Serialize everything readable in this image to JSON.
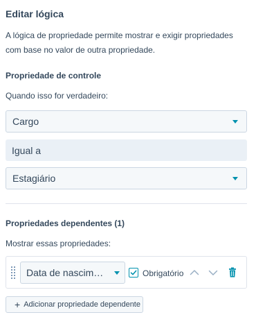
{
  "panel": {
    "title": "Editar lógica",
    "description": "A lógica de propriedade permite mostrar e exigir propriedades com base no valor de outra propriedade."
  },
  "control": {
    "heading": "Propriedade de controle",
    "hint": "Quando isso for verdadeiro:",
    "property_value": "Cargo",
    "operator_value": "Igual a",
    "match_value": "Estagiário"
  },
  "dependents": {
    "heading": "Propriedades dependentes (1)",
    "hint": "Mostrar essas propriedades:",
    "items": [
      {
        "property": "Data de nascimen...",
        "required_label": "Obrigatório",
        "required": true
      }
    ],
    "add_label": "Adicionar propriedade dependente"
  },
  "colors": {
    "accent": "#0091ae",
    "text": "#33475b",
    "field_bg": "#f5f8fa",
    "readonly_bg": "#eaf0f6",
    "border": "#cbd6e2",
    "icon_muted": "#7c98b6"
  },
  "icons": [
    "caret-down-icon",
    "drag-handle-icon",
    "checkbox-icon",
    "chevron-up-icon",
    "chevron-down-icon",
    "trash-icon",
    "plus-icon"
  ]
}
